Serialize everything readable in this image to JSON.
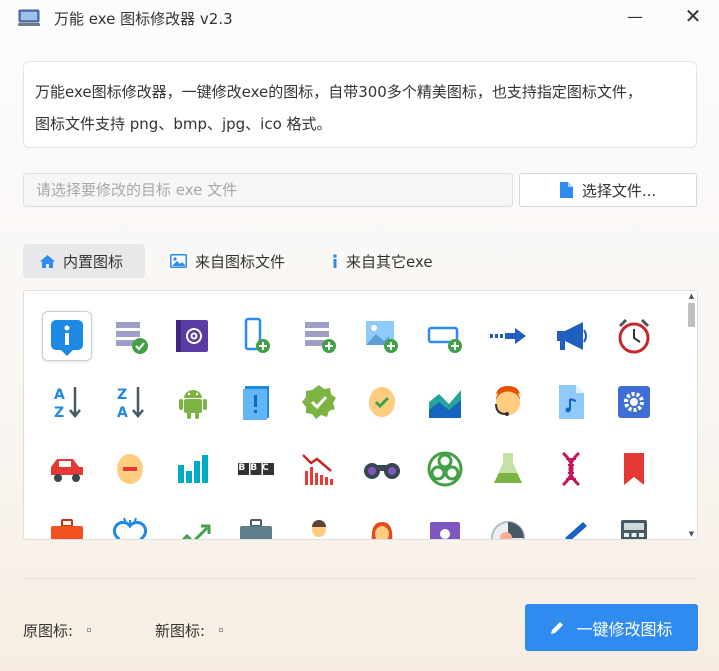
{
  "window": {
    "title": "万能 exe 图标修改器 v2.3",
    "minimize_glyph": "—",
    "close_glyph": "✕",
    "app_icon": "laptop-icon"
  },
  "description": {
    "line1": "万能exe图标修改器，一键修改exe的图标，自带300多个精美图标，也支持指定图标文件，",
    "line2": "图标文件支持 png、bmp、jpg、ico 格式。"
  },
  "file_select": {
    "placeholder": "请选择要修改的目标 exe 文件",
    "value": "",
    "button_label": "选择文件...",
    "button_icon": "file-icon"
  },
  "tabs": [
    {
      "label": "内置图标",
      "icon": "home-icon",
      "active": true
    },
    {
      "label": "来自图标文件",
      "icon": "image-icon",
      "active": false
    },
    {
      "label": "来自其它exe",
      "icon": "info-icon",
      "active": false
    }
  ],
  "icon_grid": {
    "selected_index": 0,
    "bbc_text": "BBC",
    "icons": [
      "info-icon",
      "list-check-icon",
      "email-at-icon",
      "phone-add-icon",
      "list-add-icon",
      "image-add-icon",
      "window-add-icon",
      "arrow-right-icon",
      "megaphone-icon",
      "alarm-clock-icon",
      "sort-az-icon",
      "sort-za-icon",
      "android-icon",
      "document-alert-icon",
      "verified-badge-icon",
      "face-check-icon",
      "area-chart-icon",
      "support-agent-icon",
      "music-file-icon",
      "settings-gear-icon",
      "car-icon",
      "face-minus-icon",
      "bar-chart-icon",
      "bbc-logo-icon",
      "stock-down-icon",
      "binoculars-icon",
      "biohazard-icon",
      "flask-icon",
      "dna-icon",
      "bookmark-icon",
      "briefcase-icon",
      "broken-heart-icon",
      "trend-up-icon",
      "suitcase-icon",
      "businessman-icon",
      "businesswoman-icon",
      "contact-card-icon",
      "avatar-circle-icon",
      "brush-icon",
      "calculator-icon"
    ]
  },
  "bottom": {
    "original_label": "原图标:",
    "new_label": "新图标:",
    "action_label": "一键修改图标",
    "action_icon": "pencil-icon"
  },
  "colors": {
    "accent": "#2f8bf0",
    "green": "#4caf50",
    "orange_red": "#e74c3c",
    "purple": "#5b3aa6",
    "teal": "#17a2b8"
  }
}
